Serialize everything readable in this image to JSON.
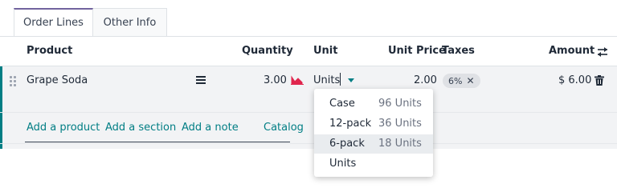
{
  "tabs": [
    {
      "label": "Order Lines",
      "active": true
    },
    {
      "label": "Other Info",
      "active": false
    }
  ],
  "columns": {
    "product": "Product",
    "quantity": "Quantity",
    "unit": "Unit",
    "unit_price": "Unit Price",
    "taxes": "Taxes",
    "amount": "Amount"
  },
  "line": {
    "product": "Grape Soda",
    "quantity": "3.00",
    "unit": "Units",
    "unit_price": "2.00",
    "tax": "6%",
    "amount": "$ 6.00"
  },
  "actions": {
    "add_product": "Add a product",
    "add_section": "Add a section",
    "add_note": "Add a note",
    "catalog": "Catalog"
  },
  "unit_dropdown": [
    {
      "name": "Case",
      "qty": "96 Units"
    },
    {
      "name": "12-pack",
      "qty": "36 Units"
    },
    {
      "name": "6-pack",
      "qty": "18 Units",
      "highlighted": true
    },
    {
      "name": "Units",
      "qty": ""
    }
  ],
  "colors": {
    "accent": "#017e84",
    "tab_border": "#71639e",
    "forecast_icon": "#e0254d"
  }
}
